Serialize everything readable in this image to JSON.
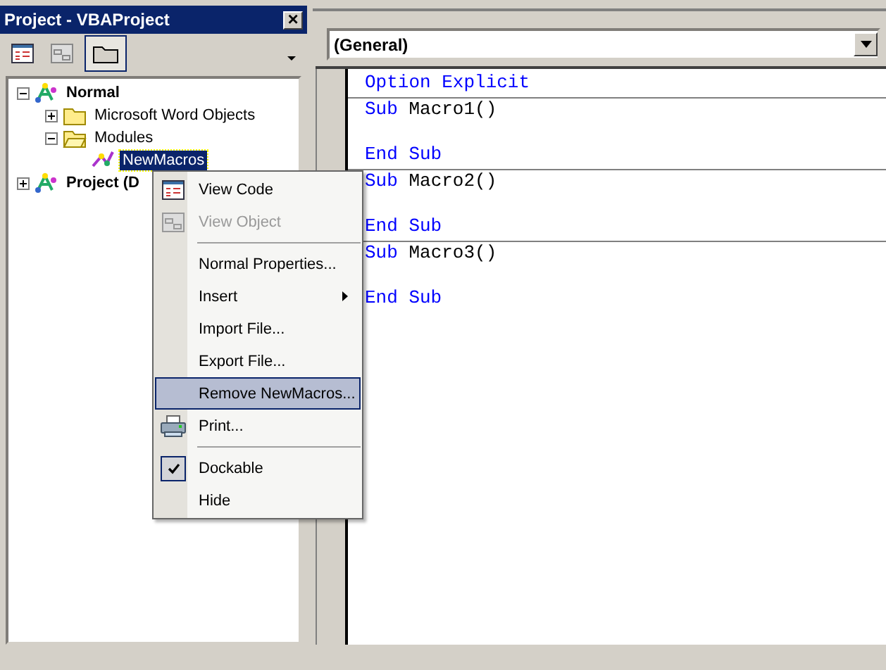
{
  "project_window": {
    "title": "Project - VBAProject",
    "close": "×",
    "toolbar": [
      {
        "kind": "view-code",
        "selected": false
      },
      {
        "kind": "view-object",
        "selected": false
      },
      {
        "kind": "toggle-folders",
        "selected": true
      }
    ],
    "tree": [
      {
        "label": "Normal",
        "kind": "project",
        "bold": true,
        "expanded": true,
        "selected": false,
        "children": [
          {
            "label": "Microsoft Word Objects",
            "kind": "folder",
            "bold": false,
            "expanded": false,
            "selected": false
          },
          {
            "label": "Modules",
            "kind": "open-folder",
            "bold": false,
            "expanded": true,
            "selected": false,
            "children": [
              {
                "label": "NewMacros",
                "kind": "module",
                "bold": false,
                "selected": true
              }
            ]
          }
        ]
      },
      {
        "label": "Project (D",
        "kind": "project",
        "bold": true,
        "expanded": false,
        "selected": false
      }
    ]
  },
  "code_window": {
    "object_box": "(General)",
    "sections": [
      {
        "kind": "declarations",
        "lines": [
          [
            {
              "text": "Option Explicit",
              "kind": "keyword"
            }
          ]
        ]
      },
      {
        "kind": "procedure",
        "first": [
          {
            "text": "Sub ",
            "kind": "keyword"
          },
          {
            "text": "Macro1()",
            "kind": "plain"
          }
        ],
        "last": [
          {
            "text": "End Sub",
            "kind": "keyword"
          }
        ]
      },
      {
        "kind": "procedure",
        "first": [
          {
            "text": "Sub ",
            "kind": "keyword"
          },
          {
            "text": "Macro2()",
            "kind": "plain"
          }
        ],
        "last": [
          {
            "text": "End Sub",
            "kind": "keyword"
          }
        ]
      },
      {
        "kind": "procedure",
        "first": [
          {
            "text": "Sub ",
            "kind": "keyword"
          },
          {
            "text": "Macro3()",
            "kind": "plain"
          }
        ],
        "last": [
          {
            "text": "End Sub",
            "kind": "keyword"
          }
        ]
      }
    ]
  },
  "context_menu": [
    {
      "kind": "view-code",
      "label": "View Code",
      "disabled": false,
      "selected": false
    },
    {
      "kind": "view-object",
      "label": "View Object",
      "disabled": true,
      "selected": false
    },
    {
      "kind": "separator"
    },
    {
      "kind": "item",
      "label": "Normal Properties...",
      "disabled": false,
      "selected": false
    },
    {
      "kind": "item",
      "label": "Insert",
      "submenu": true,
      "disabled": false,
      "selected": false
    },
    {
      "kind": "item",
      "label": "Import File...",
      "disabled": false,
      "selected": false
    },
    {
      "kind": "item",
      "label": "Export File...",
      "disabled": false,
      "selected": false
    },
    {
      "kind": "item",
      "label": "Remove NewMacros...",
      "disabled": false,
      "selected": true
    },
    {
      "kind": "print",
      "label": "Print...",
      "disabled": false,
      "selected": false
    },
    {
      "kind": "separator"
    },
    {
      "kind": "item",
      "label": "Dockable",
      "checked": true,
      "disabled": false,
      "selected": false
    },
    {
      "kind": "item",
      "label": "Hide",
      "disabled": false,
      "selected": false
    }
  ]
}
